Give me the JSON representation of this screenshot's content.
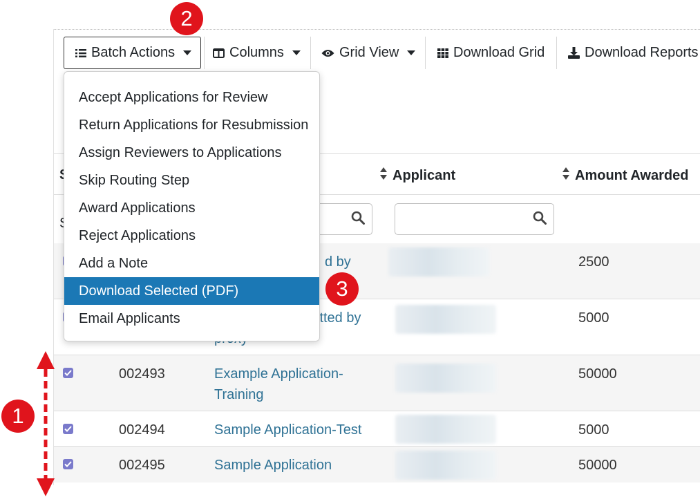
{
  "toolbar": {
    "batch_actions": "Batch Actions",
    "columns": "Columns",
    "grid_view": "Grid View",
    "download_grid": "Download Grid",
    "download_reports": "Download Reports"
  },
  "batch_menu": {
    "items": [
      "Accept Applications for Review",
      "Return Applications for Resubmission",
      "Assign Reviewers to Applications",
      "Skip Routing Step",
      "Award Applications",
      "Reject Applications",
      "Add a Note",
      "Download Selected (PDF)",
      "Email Applicants"
    ],
    "active_item": "Download Selected (PDF)"
  },
  "table": {
    "headers": {
      "first_partial": "S",
      "applicant": "Applicant",
      "amount_awarded": "Amount Awarded"
    },
    "filter_partial": "S",
    "rows": [
      {
        "id": "",
        "name_visible": "d by",
        "amount": "2500",
        "checked": true
      },
      {
        "id": "",
        "name_visible": "itted by",
        "name_line2": "proxy",
        "amount": "5000",
        "checked": true
      },
      {
        "id": "002493",
        "name_visible": "Example Application-",
        "name_line2": "Training",
        "amount": "50000",
        "checked": true
      },
      {
        "id": "002494",
        "name_visible": "Sample Application-Test",
        "amount": "5000",
        "checked": true
      },
      {
        "id": "002495",
        "name_visible": "Sample Application",
        "amount": "50000",
        "checked": true
      }
    ]
  },
  "annotations": {
    "badge_1": "1",
    "badge_2": "2",
    "badge_3": "3"
  },
  "colors": {
    "accent_blue": "#1b78b5",
    "link": "#2f7295",
    "badge_red": "#e0141c",
    "checkbox": "#7a7acb"
  }
}
